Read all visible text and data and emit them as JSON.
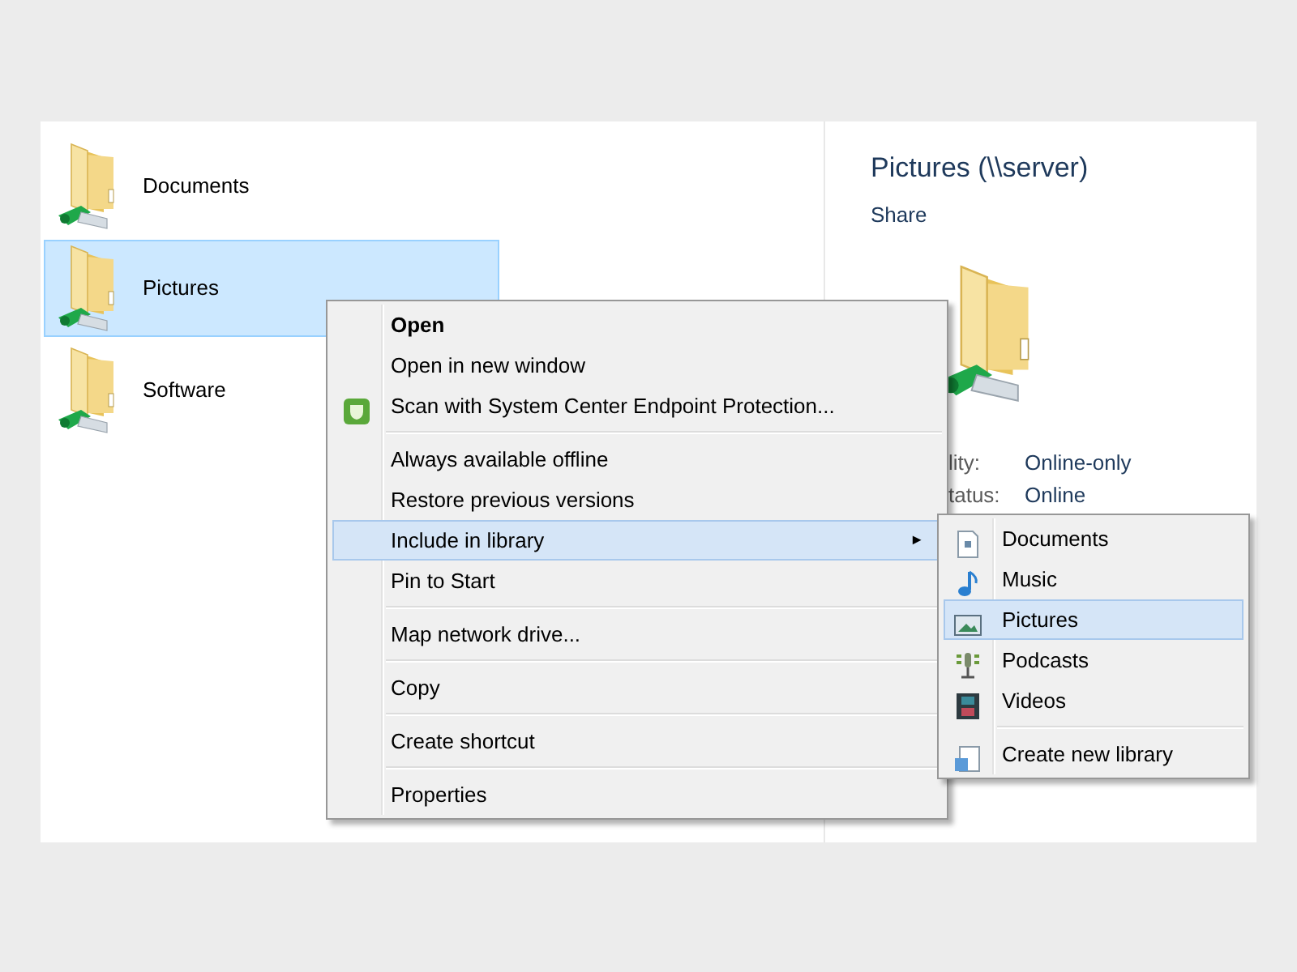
{
  "folders": [
    {
      "name": "Documents",
      "selected": false
    },
    {
      "name": "Pictures",
      "selected": true
    },
    {
      "name": "Software",
      "selected": false
    }
  ],
  "details": {
    "title": "Pictures (\\\\server)",
    "subtitle": "Share",
    "properties": [
      {
        "label": "lity:",
        "value": "Online-only"
      },
      {
        "label": "tatus:",
        "value": "Online"
      }
    ]
  },
  "context_menu": {
    "items": [
      {
        "kind": "item",
        "label": "Open",
        "default": true,
        "selected": false
      },
      {
        "kind": "item",
        "label": "Open in new window",
        "default": false,
        "selected": false
      },
      {
        "kind": "item",
        "label": "Scan with System Center Endpoint Protection...",
        "default": false,
        "selected": false
      },
      {
        "kind": "separator"
      },
      {
        "kind": "item",
        "label": "Always available offline",
        "default": false,
        "selected": false
      },
      {
        "kind": "item",
        "label": "Restore previous versions",
        "default": false,
        "selected": false
      },
      {
        "kind": "item",
        "label": "Include in library",
        "default": false,
        "selected": true,
        "arrow": "►"
      },
      {
        "kind": "item",
        "label": "Pin to Start",
        "default": false,
        "selected": false
      },
      {
        "kind": "separator"
      },
      {
        "kind": "item",
        "label": "Map network drive...",
        "default": false,
        "selected": false
      },
      {
        "kind": "separator"
      },
      {
        "kind": "item",
        "label": "Copy",
        "default": false,
        "selected": false
      },
      {
        "kind": "separator"
      },
      {
        "kind": "item",
        "label": "Create shortcut",
        "default": false,
        "selected": false
      },
      {
        "kind": "separator"
      },
      {
        "kind": "item",
        "label": "Properties",
        "default": false,
        "selected": false
      }
    ]
  },
  "submenu": {
    "items": [
      {
        "kind": "item",
        "label": "Documents",
        "selected": false
      },
      {
        "kind": "item",
        "label": "Music",
        "selected": false
      },
      {
        "kind": "item",
        "label": "Pictures",
        "selected": true
      },
      {
        "kind": "item",
        "label": "Podcasts",
        "selected": false
      },
      {
        "kind": "item",
        "label": "Videos",
        "selected": false
      },
      {
        "kind": "separator"
      },
      {
        "kind": "item",
        "label": "Create new library",
        "selected": false
      }
    ]
  }
}
